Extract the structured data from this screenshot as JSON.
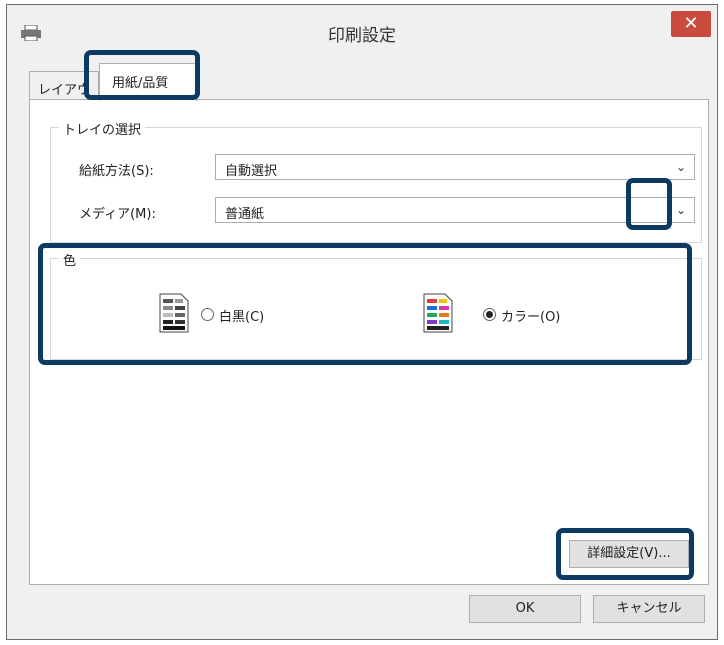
{
  "window": {
    "title": "印刷設定",
    "close_label": "✕"
  },
  "tabs": [
    {
      "label": "レイアウ"
    },
    {
      "label": "用紙/品質"
    }
  ],
  "tray_group": {
    "legend": "トレイの選択",
    "paper_source": {
      "label": "給紙方法(S):",
      "value": "自動選択"
    },
    "media": {
      "label": "メディア(M):",
      "value": "普通紙"
    }
  },
  "color_group": {
    "legend": "色",
    "options": [
      {
        "label": "白黒(C)",
        "selected": false
      },
      {
        "label": "カラー(O)",
        "selected": true
      }
    ]
  },
  "buttons": {
    "advanced": "詳細設定(V)...",
    "ok": "OK",
    "cancel": "キャンセル"
  },
  "icons": {
    "chevron": "⌄",
    "printer": "printer-icon",
    "bw_doc": "grayscale-document-icon",
    "color_doc": "color-document-icon"
  },
  "colors": {
    "highlight": "#0d3a63",
    "close_button": "#c94b3e"
  }
}
